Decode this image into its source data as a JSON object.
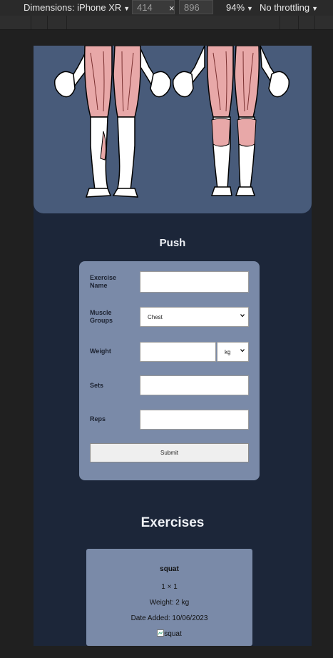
{
  "devtools": {
    "device_label": "Dimensions: iPhone XR",
    "width": "414",
    "height": "896",
    "times": "×",
    "zoom": "94%",
    "throttle": "No throttling"
  },
  "form": {
    "title": "Push",
    "exercise_name_label": "Exercise Name",
    "exercise_name_value": "",
    "muscle_groups_label": "Muscle Groups",
    "muscle_groups_selected": "Chest",
    "weight_label": "Weight",
    "weight_value": "",
    "weight_unit": "kg",
    "sets_label": "Sets",
    "sets_value": "",
    "reps_label": "Reps",
    "reps_value": "",
    "submit_label": "Submit"
  },
  "exercises": {
    "title": "Exercises",
    "items": [
      {
        "name": "squat",
        "sets_reps": "1 × 1",
        "weight": "Weight: 2 kg",
        "date": "Date Added: 10/06/2023",
        "image_alt": "squat"
      }
    ]
  },
  "colors": {
    "page_bg": "#1c2639",
    "hero_bg": "#485b7a",
    "card_bg": "#7a8aa8",
    "muscle_highlight": "#e8a8a8"
  }
}
